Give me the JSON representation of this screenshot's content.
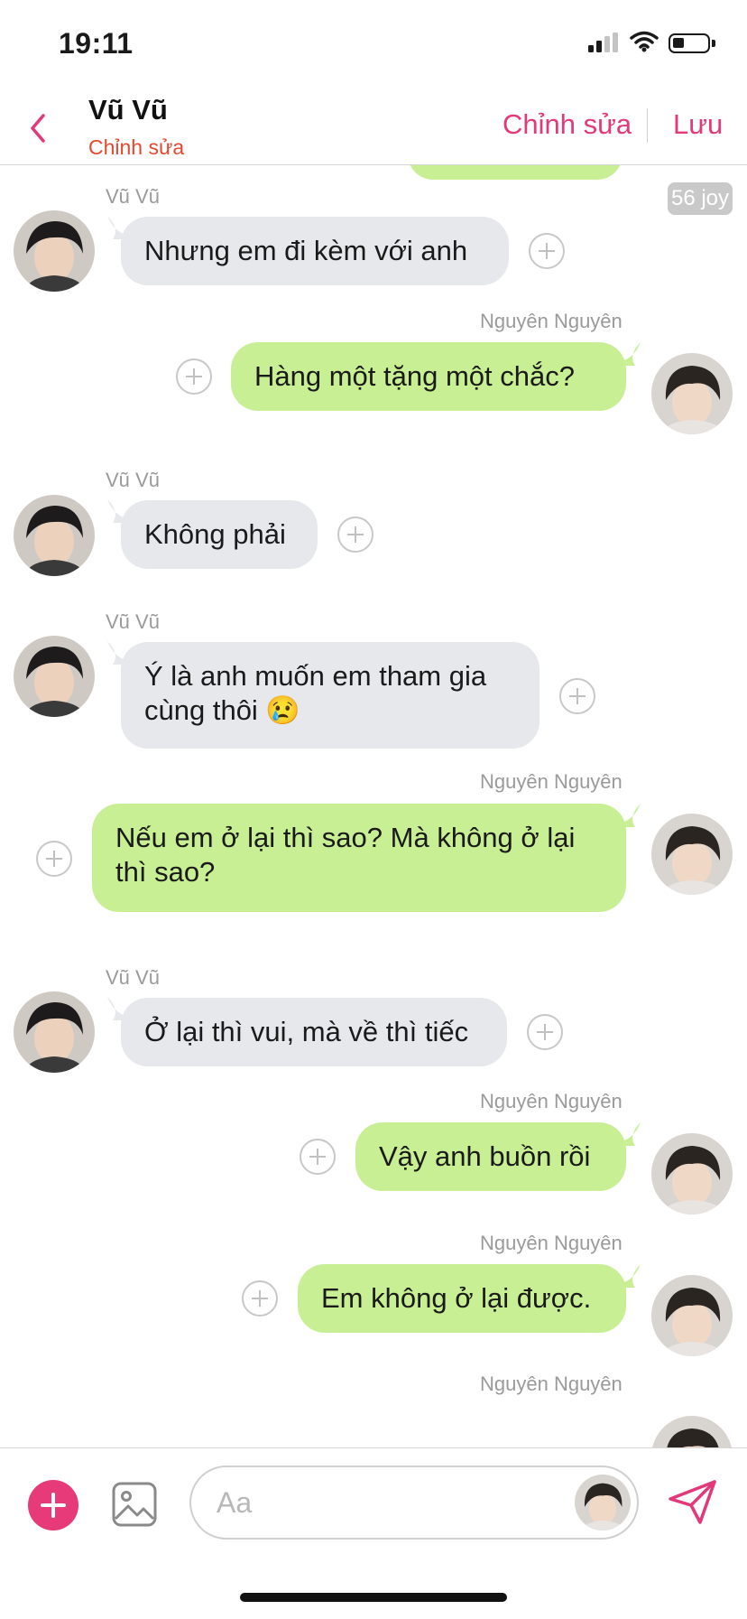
{
  "status_bar": {
    "time": "19:11"
  },
  "header": {
    "contact_name": "Vũ Vũ",
    "subtitle": "Chỉnh sửa",
    "edit_label": "Chỉnh sửa",
    "save_label": "Lưu",
    "accent_color": "#e2397b"
  },
  "chat": {
    "stamp": "56 joy",
    "messages": [
      {
        "sender": "Vũ Vũ",
        "lines": [
          "Nhưng em đi kèm với anh"
        ],
        "direction": "incoming"
      },
      {
        "sender": "Nguyên Nguyên",
        "lines": [
          "Hàng một tặng một chắc?"
        ],
        "direction": "outgoing"
      },
      {
        "sender": "Vũ Vũ",
        "lines": [
          "Không phải"
        ],
        "direction": "incoming"
      },
      {
        "sender": "Vũ Vũ",
        "lines": [
          "Ý là anh muốn em tham gia",
          "cùng thôi 😢"
        ],
        "direction": "incoming"
      },
      {
        "sender": "Nguyên Nguyên",
        "lines": [
          "Nếu em ở lại thì sao? Mà không ở lại",
          "thì sao?"
        ],
        "direction": "outgoing"
      },
      {
        "sender": "Vũ Vũ",
        "lines": [
          "Ở lại thì vui, mà về thì tiếc"
        ],
        "direction": "incoming"
      },
      {
        "sender": "Nguyên Nguyên",
        "lines": [
          "Vậy anh buồn rồi"
        ],
        "direction": "outgoing"
      },
      {
        "sender": "Nguyên Nguyên",
        "lines": [
          "Em không ở lại được."
        ],
        "direction": "outgoing"
      },
      {
        "sender": "Nguyên Nguyên",
        "lines": [],
        "direction": "outgoing"
      }
    ],
    "incoming_color": "#e6e8eb",
    "outgoing_color": "#c9ef95"
  },
  "input_bar": {
    "placeholder": "Aa",
    "icons": [
      "plus-icon",
      "image-icon",
      "send-icon"
    ]
  }
}
